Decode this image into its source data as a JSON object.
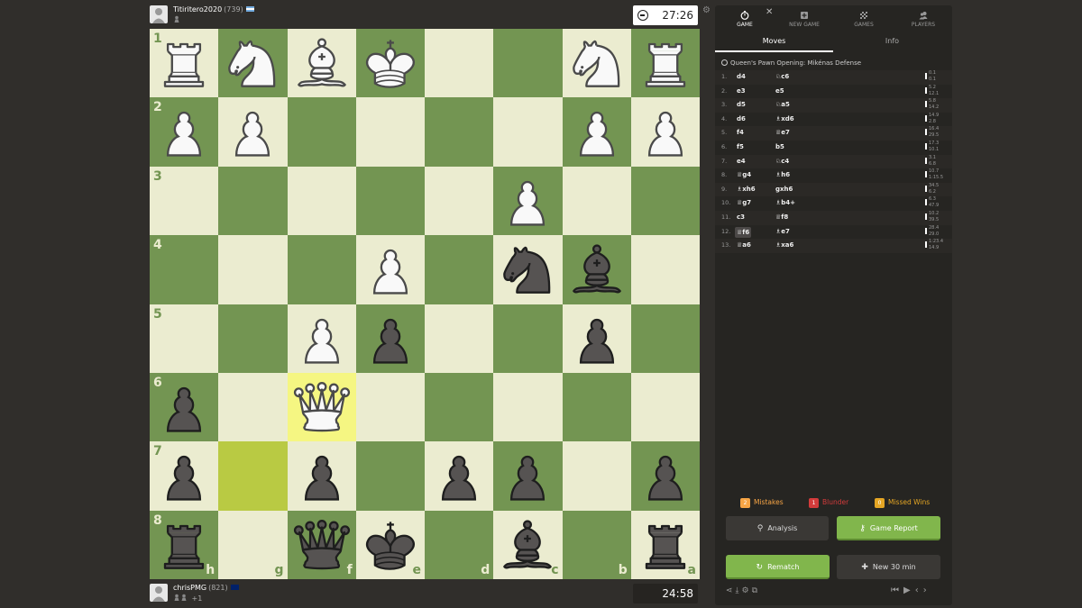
{
  "top_player": {
    "name": "Titiritero2020",
    "rating": "(739)",
    "flag_color": "#74acdf",
    "clock": "27:26"
  },
  "bottom_player": {
    "name": "chrisPMG",
    "rating": "(821)",
    "flag_color": "#012169",
    "material": "+1",
    "clock": "24:58"
  },
  "board": {
    "orientation": "black",
    "ranks": [
      "1",
      "2",
      "3",
      "4",
      "5",
      "6",
      "7",
      "8"
    ],
    "files": [
      "h",
      "g",
      "f",
      "e",
      "d",
      "c",
      "b",
      "a"
    ],
    "highlight_squares": [
      "g7"
    ],
    "selected_square": "f6",
    "pieces": [
      {
        "sq": "h1",
        "p": "wR"
      },
      {
        "sq": "g1",
        "p": "wN"
      },
      {
        "sq": "f1",
        "p": "wB"
      },
      {
        "sq": "e1",
        "p": "wK"
      },
      {
        "sq": "b1",
        "p": "wN"
      },
      {
        "sq": "a1",
        "p": "wR"
      },
      {
        "sq": "h2",
        "p": "wP"
      },
      {
        "sq": "g2",
        "p": "wP"
      },
      {
        "sq": "b2",
        "p": "wP"
      },
      {
        "sq": "a2",
        "p": "wP"
      },
      {
        "sq": "c3",
        "p": "wP"
      },
      {
        "sq": "e4",
        "p": "wP"
      },
      {
        "sq": "c4",
        "p": "bN"
      },
      {
        "sq": "b4",
        "p": "bB"
      },
      {
        "sq": "f5",
        "p": "wP"
      },
      {
        "sq": "e5",
        "p": "bP"
      },
      {
        "sq": "b5",
        "p": "bP"
      },
      {
        "sq": "h6",
        "p": "bP"
      },
      {
        "sq": "f6",
        "p": "wQ"
      },
      {
        "sq": "h7",
        "p": "bP"
      },
      {
        "sq": "f7",
        "p": "bP"
      },
      {
        "sq": "d7",
        "p": "bP"
      },
      {
        "sq": "c7",
        "p": "bP"
      },
      {
        "sq": "a7",
        "p": "bP"
      },
      {
        "sq": "h8",
        "p": "bR"
      },
      {
        "sq": "f8",
        "p": "bQ"
      },
      {
        "sq": "e8",
        "p": "bK"
      },
      {
        "sq": "c8",
        "p": "bB"
      },
      {
        "sq": "a8",
        "p": "bR"
      }
    ]
  },
  "panel": {
    "tabs": [
      {
        "label": "GAME",
        "icon": "stopwatch-icon"
      },
      {
        "label": "NEW GAME",
        "icon": "plus-square-icon"
      },
      {
        "label": "GAMES",
        "icon": "board-icon"
      },
      {
        "label": "PLAYERS",
        "icon": "players-icon"
      }
    ],
    "subtabs": [
      "Moves",
      "Info"
    ],
    "opening": "Queen's Pawn Opening: Mikénas Defense",
    "moves": [
      {
        "n": "1.",
        "w": "d4",
        "b": "♘c6",
        "t1": "0.1",
        "t2": "0.1"
      },
      {
        "n": "2.",
        "w": "e3",
        "b": "e5",
        "t1": "5.2",
        "t2": "12.1"
      },
      {
        "n": "3.",
        "w": "d5",
        "b": "♘a5",
        "t1": "5.8",
        "t2": "14.2"
      },
      {
        "n": "4.",
        "w": "d6",
        "b": "♗xd6",
        "t1": "14.9",
        "t2": "2.8"
      },
      {
        "n": "5.",
        "w": "f4",
        "b": "♕e7",
        "t1": "16.4",
        "t2": "29.5"
      },
      {
        "n": "6.",
        "w": "f5",
        "b": "b5",
        "t1": "17.3",
        "t2": "10.1"
      },
      {
        "n": "7.",
        "w": "e4",
        "b": "♘c4",
        "t1": "3.1",
        "t2": "6.8"
      },
      {
        "n": "8.",
        "w": "♕g4",
        "b": "♗h6",
        "t1": "10.7",
        "t2": "1:15.5"
      },
      {
        "n": "9.",
        "w": "♗xh6",
        "b": "gxh6",
        "t1": "34.5",
        "t2": "6.2"
      },
      {
        "n": "10.",
        "w": "♕g7",
        "b": "♗b4+",
        "t1": "6.3",
        "t2": "47.9"
      },
      {
        "n": "11.",
        "w": "c3",
        "b": "♕f8",
        "t1": "10.2",
        "t2": "39.5"
      },
      {
        "n": "12.",
        "w": "♕f6",
        "b": "♗e7",
        "t1": "28.4",
        "t2": "29.0"
      },
      {
        "n": "13.",
        "w": "♕a6",
        "b": "♗xa6",
        "t1": "1:23.4",
        "t2": "14.9"
      }
    ],
    "current_move_index": 11,
    "summary": [
      {
        "count": "2",
        "label": "Mistakes",
        "color": "#f7a545"
      },
      {
        "count": "1",
        "label": "Blunder",
        "color": "#d33b3b"
      },
      {
        "count": "0",
        "label": "Missed Wins",
        "color": "#e5a624"
      }
    ],
    "buttons": {
      "analysis": "Analysis",
      "report": "Game Report",
      "rematch": "Rematch",
      "new": "New 30 min"
    },
    "colors": {
      "green_button": "#81b64c",
      "board_light": "#ebecd0",
      "board_dark": "#739552"
    }
  }
}
